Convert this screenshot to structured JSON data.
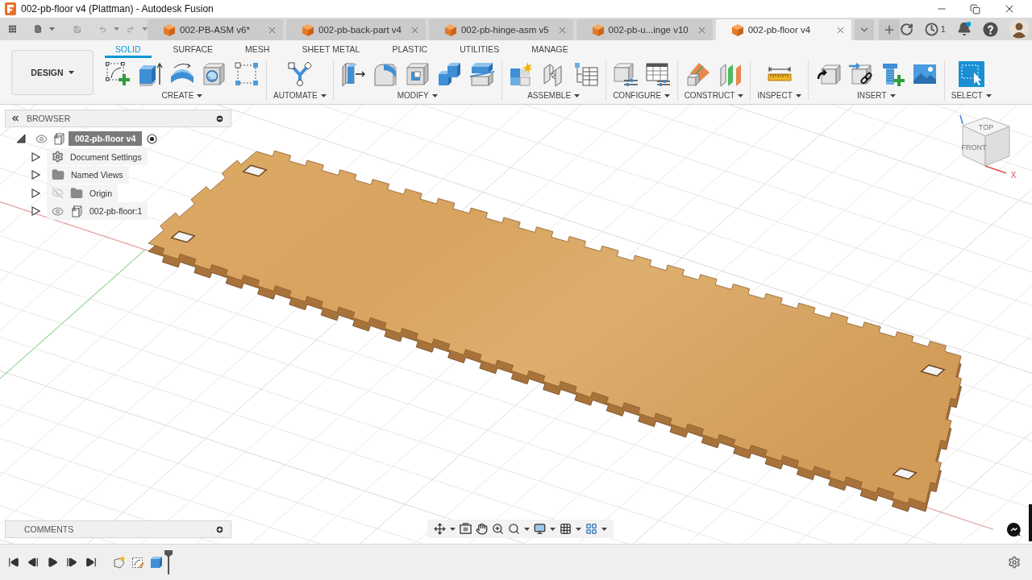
{
  "window": {
    "title": "002-pb-floor v4 (Plattman) - Autodesk Fusion"
  },
  "document_tabs": [
    {
      "label": "002-PB-ASM v6*",
      "selected": false
    },
    {
      "label": "002-pb-back-part v4",
      "selected": false
    },
    {
      "label": "002-pb-hinge-asm v5",
      "selected": false
    },
    {
      "label": "002-pb-u...inge v10",
      "selected": false
    },
    {
      "label": "002-pb-floor v4",
      "selected": true
    }
  ],
  "header": {
    "job_count": "1",
    "has_notifications": true
  },
  "workspace": {
    "label": "DESIGN"
  },
  "toolbar_tabs": [
    {
      "label": "SOLID",
      "selected": true
    },
    {
      "label": "SURFACE",
      "selected": false
    },
    {
      "label": "MESH",
      "selected": false
    },
    {
      "label": "SHEET METAL",
      "selected": false
    },
    {
      "label": "PLASTIC",
      "selected": false
    },
    {
      "label": "UTILITIES",
      "selected": false
    },
    {
      "label": "MANAGE",
      "selected": false
    }
  ],
  "tool_groups": [
    {
      "label": "CREATE"
    },
    {
      "label": "AUTOMATE"
    },
    {
      "label": "MODIFY"
    },
    {
      "label": "ASSEMBLE"
    },
    {
      "label": "CONFIGURE"
    },
    {
      "label": "CONSTRUCT"
    },
    {
      "label": "INSPECT"
    },
    {
      "label": "INSERT"
    },
    {
      "label": "SELECT"
    }
  ],
  "browser": {
    "title": "BROWSER",
    "root": {
      "label": "002-pb-floor v4",
      "expanded": true,
      "visible": true,
      "active": true,
      "children": [
        {
          "label": "Document Settings",
          "kind": "settings",
          "expanded": false
        },
        {
          "label": "Named Views",
          "kind": "folder",
          "expanded": false
        },
        {
          "label": "Origin",
          "kind": "folder",
          "expanded": false,
          "visible": false
        },
        {
          "label": "002-pb-floor:1",
          "kind": "component",
          "expanded": false,
          "visible": true
        }
      ]
    }
  },
  "view_cube": {
    "faces": [
      "TOP",
      "FRONT"
    ],
    "axis_label": "X"
  },
  "comments": {
    "title": "COMMENTS"
  }
}
